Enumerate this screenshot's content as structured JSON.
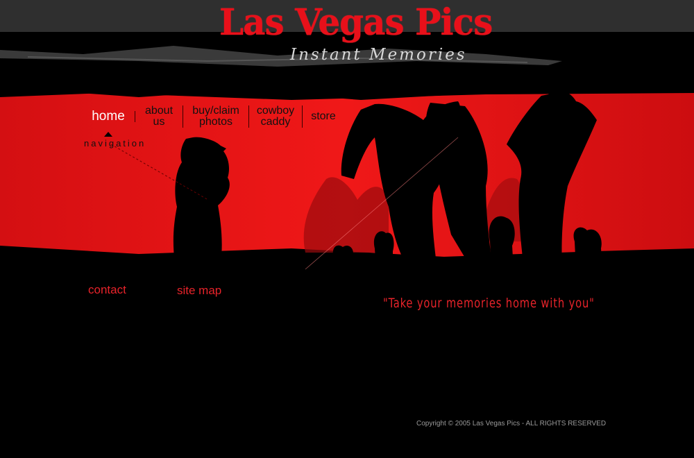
{
  "header": {
    "title": "Las Vegas Pics",
    "subtitle": "Instant Memories"
  },
  "nav": {
    "items": [
      {
        "label_line1": "home",
        "label_line2": ""
      },
      {
        "label_line1": "about",
        "label_line2": "us"
      },
      {
        "label_line1": "buy/claim",
        "label_line2": "photos"
      },
      {
        "label_line1": "cowboy",
        "label_line2": "caddy"
      },
      {
        "label_line1": "store",
        "label_line2": ""
      }
    ],
    "active": "home",
    "caption": "navigation"
  },
  "footer_links": {
    "contact": "contact",
    "sitemap": "site map"
  },
  "slogan": "\"Take your memories home with you\"",
  "copyright": "Copyright © 2005 Las Vegas Pics - ALL RIGHTS RESERVED",
  "colors": {
    "brand_red": "#e8101a",
    "hero_red": "#e61414",
    "background": "#000000",
    "top_bar": "#2f2f2f"
  },
  "icons": {
    "nav_indicator": "triangle-up-icon"
  }
}
